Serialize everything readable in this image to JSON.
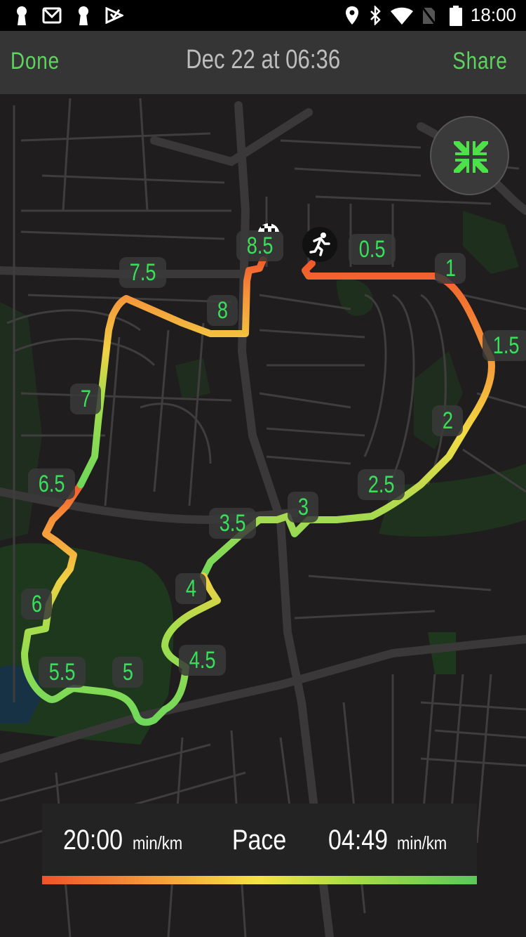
{
  "status_bar": {
    "left_icons": [
      "keyhole-icon",
      "gmail-icon",
      "keyhole-icon",
      "task-icon"
    ],
    "right_icons": [
      "location-icon",
      "bluetooth-icon",
      "wifi-icon",
      "no-sim-icon",
      "battery-icon"
    ],
    "time": "18:00"
  },
  "nav": {
    "done_label": "Done",
    "title": "Dec 22 at 06:36",
    "share_label": "Share",
    "accent_color": "#5fd35f"
  },
  "map": {
    "collapse_button_icon": "collapse-arrows-icon",
    "start_marker_icon": "runner-icon",
    "finish_marker_icon": "checkered-flag-icon",
    "km_markers": [
      "0.5",
      "1",
      "1.5",
      "2",
      "2.5",
      "3",
      "3.5",
      "4",
      "4.5",
      "5",
      "5.5",
      "6",
      "6.5",
      "7",
      "7.5",
      "8",
      "8.5"
    ]
  },
  "pace_legend": {
    "slowest_value": "20:00",
    "slowest_unit": "min/km",
    "label": "Pace",
    "fastest_value": "04:49",
    "fastest_unit": "min/km",
    "gradient_colors": [
      "#f0522c",
      "#f59a38",
      "#f6e342",
      "#a6dc44",
      "#5cc85c"
    ]
  }
}
